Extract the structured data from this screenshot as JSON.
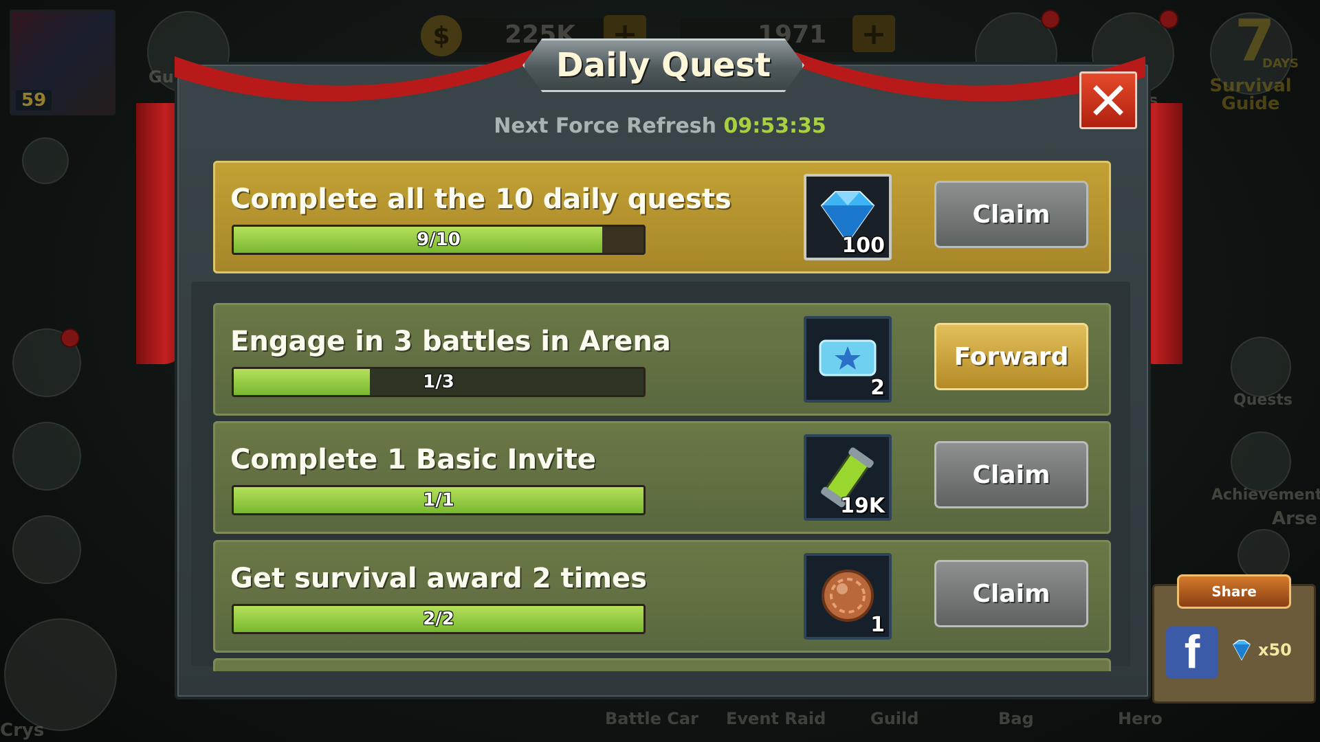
{
  "hud": {
    "player_level": "59",
    "gold": "225K",
    "gems": "1971",
    "left_label_partial": "Gu",
    "survival_days": "7",
    "survival_days_label": "DAYS",
    "survival_guide_label": "Survival Guide",
    "quests_label": "Quests",
    "achievement_label": "Achievement",
    "arsenal_partial": "Arse",
    "crys_partial": "Crys",
    "s_partial": "s"
  },
  "bottom_nav": {
    "items": [
      "Battle Car",
      "Event Raid",
      "Guild",
      "Bag",
      "Hero"
    ]
  },
  "share": {
    "label": "Share",
    "fb_letter": "f",
    "reward": "x50"
  },
  "dialog": {
    "title": "Daily Quest",
    "refresh_label": "Next Force Refresh",
    "refresh_time": "09:53:35",
    "quests": [
      {
        "text": "Complete all the 10 daily quests",
        "progress": "9/10",
        "fraction": 0.9,
        "reward_icon": "diamond-icon",
        "reward_amount": "100",
        "button": "Claim",
        "button_type": "claim",
        "row_style": "gold"
      },
      {
        "text": "Engage in 3 battles in Arena",
        "progress": "1/3",
        "fraction": 0.333,
        "reward_icon": "arena-ticket-icon",
        "reward_amount": "2",
        "button": "Forward",
        "button_type": "forward",
        "row_style": "green"
      },
      {
        "text": "Complete 1 Basic Invite",
        "progress": "1/1",
        "fraction": 1.0,
        "reward_icon": "energy-canister-icon",
        "reward_amount": "19K",
        "button": "Claim",
        "button_type": "claim",
        "row_style": "green"
      },
      {
        "text": "Get survival award 2 times",
        "progress": "2/2",
        "fraction": 1.0,
        "reward_icon": "bronze-coin-icon",
        "reward_amount": "1",
        "button": "Claim",
        "button_type": "claim",
        "row_style": "green"
      }
    ]
  },
  "colors": {
    "accent_gold": "#c2a134",
    "timer_green": "#a8d040",
    "close_red": "#d43a20",
    "progress_green": "#8cc63f"
  }
}
